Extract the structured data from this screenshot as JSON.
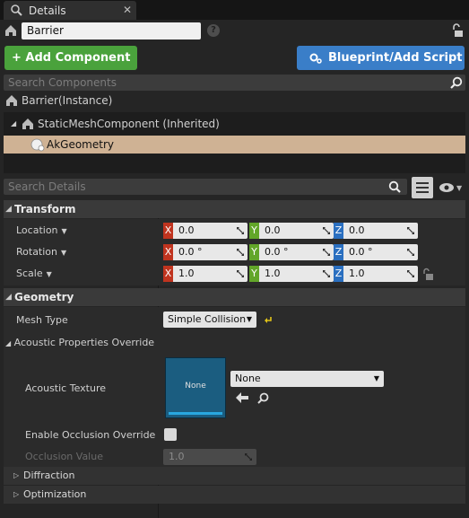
{
  "tab": {
    "title": "Details",
    "close": "✕"
  },
  "header": {
    "actor_name": "Barrier",
    "help": "?",
    "add_component": "+ Add Component ▾",
    "blueprint": "Blueprint/Add Script"
  },
  "components": {
    "search_placeholder": "Search Components",
    "instance": "Barrier(Instance)",
    "root": "StaticMeshComponent (Inherited)",
    "selected": "AkGeometry"
  },
  "details": {
    "search_placeholder": "Search Details"
  },
  "transform": {
    "title": "Transform",
    "location": {
      "label": "Location",
      "x": "0.0",
      "y": "0.0",
      "z": "0.0"
    },
    "rotation": {
      "label": "Rotation",
      "x": "0.0 °",
      "y": "0.0 °",
      "z": "0.0 °"
    },
    "scale": {
      "label": "Scale",
      "x": "1.0",
      "y": "1.0",
      "z": "1.0"
    }
  },
  "geometry": {
    "title": "Geometry",
    "mesh_type_label": "Mesh Type",
    "mesh_type_value": "Simple Collision",
    "acoustic_override": "Acoustic Properties Override",
    "acoustic_texture_label": "Acoustic Texture",
    "thumbnail_text": "None",
    "texture_value": "None",
    "occlusion_override_label": "Enable Occlusion Override",
    "occlusion_value_label": "Occlusion Value",
    "occlusion_value": "1.0",
    "diffraction": "Diffraction",
    "optimization": "Optimization"
  },
  "colors": {
    "add_button": "#4aa23c",
    "blueprint_button": "#3a7ec8",
    "selected_row": "#cfb294",
    "axis_x": "#c0341f",
    "axis_y": "#62a629",
    "axis_z": "#2a6fc0",
    "reset_arrow": "#e2c418"
  }
}
